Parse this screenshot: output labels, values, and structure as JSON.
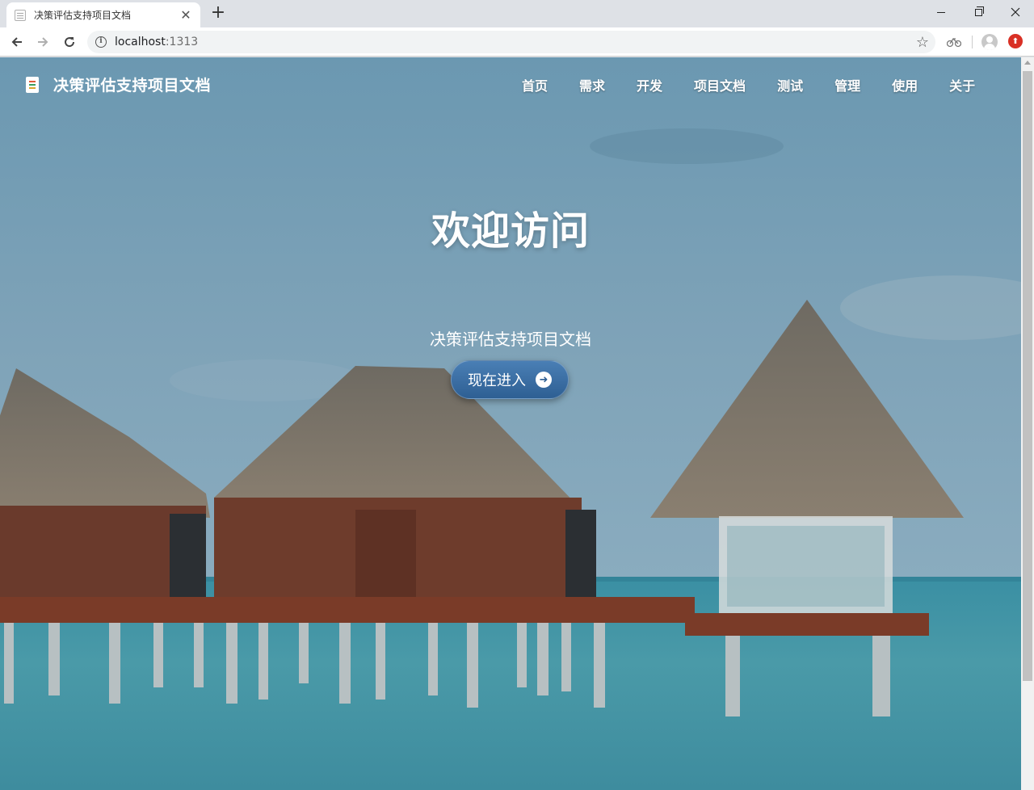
{
  "browser": {
    "tab_title": "决策评估支持项目文档",
    "tab_close": "✕",
    "new_tab": "+",
    "url_host": "localhost",
    "url_port": ":1313"
  },
  "site": {
    "brand_title": "决策评估支持项目文档",
    "nav": [
      "首页",
      "需求",
      "开发",
      "项目文档",
      "测试",
      "管理",
      "使用",
      "关于"
    ]
  },
  "hero": {
    "title": "欢迎访问",
    "subtitle": "决策评估支持项目文档",
    "cta_label": "现在进入"
  },
  "colors": {
    "sky": "#6f9bb3",
    "sea": "#3f8fa3",
    "cta": "#3a6fa6",
    "update_badge": "#d93025"
  }
}
